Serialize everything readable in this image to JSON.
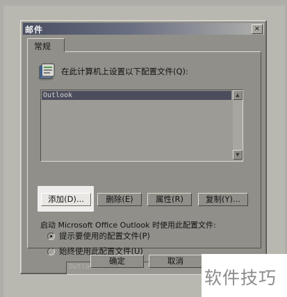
{
  "dialog": {
    "title": "邮件",
    "close_glyph": "×",
    "tab": "常规",
    "prompt": "在此计算机上设置以下配置文件(Q):",
    "profiles": [
      "Outlook"
    ],
    "scroll_up": "▲",
    "scroll_down": "▼",
    "buttons": {
      "add": "添加(D)...",
      "remove": "删除(E)",
      "properties": "属性(R)",
      "copy": "复制(Y)..."
    },
    "startup_label": "启动 Microsoft Office Outlook 时使用此配置文件:",
    "radio_prompt": "提示要使用的配置文件(P)",
    "radio_always": "始终使用此配置文件(U)",
    "combo_value": "Outlook",
    "combo_arrow": "▼",
    "ok": "确定",
    "cancel": "取消"
  },
  "watermark": "软件技巧",
  "colors": {
    "dialog_face": "#908f89",
    "title_start": "#494e62",
    "selection": "#4c4d5c",
    "highlight": "#efedeb"
  },
  "icons": {
    "profile": "address-book-icon"
  }
}
